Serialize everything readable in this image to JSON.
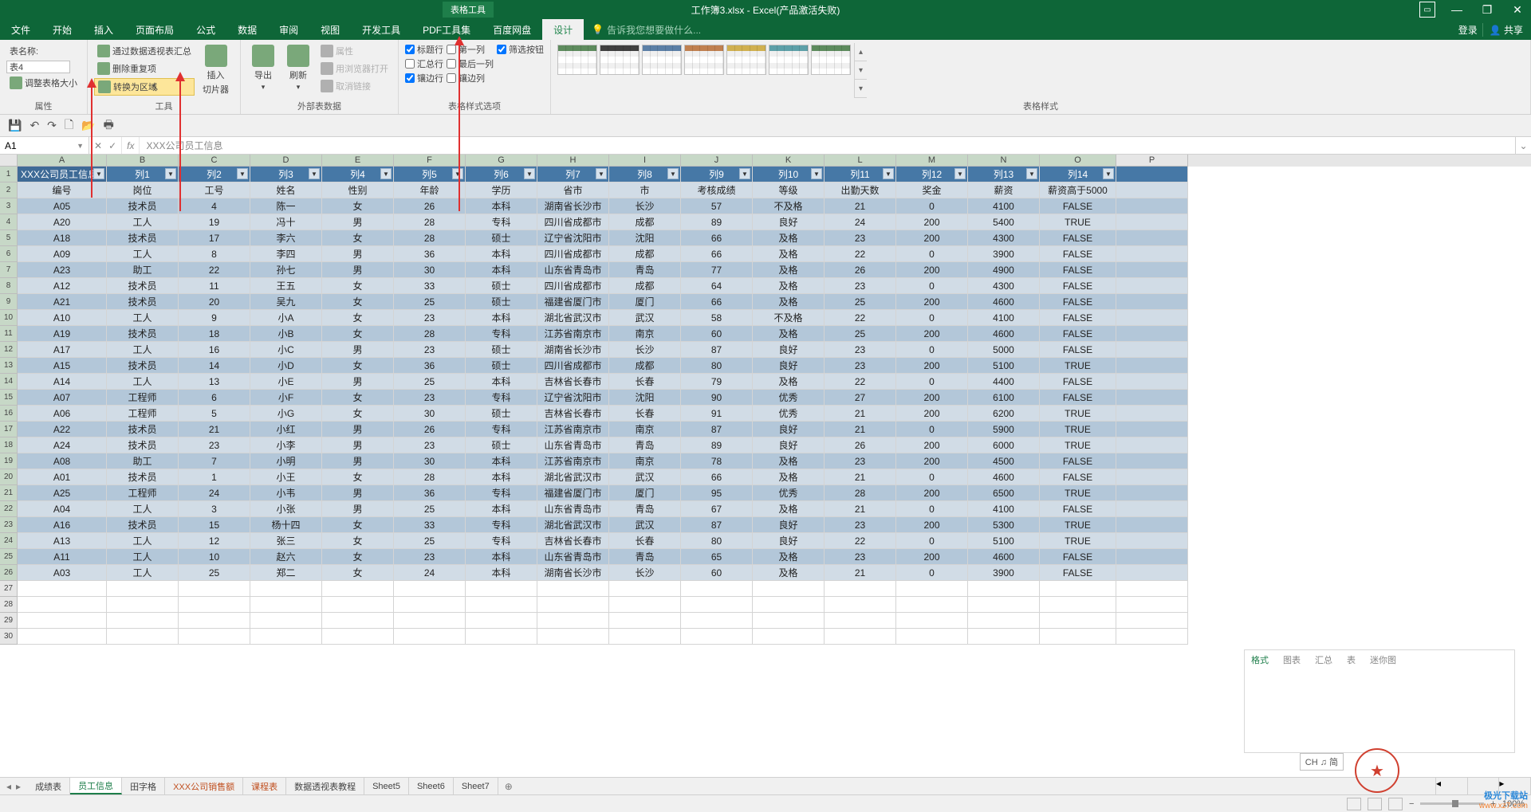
{
  "title": {
    "tool": "表格工具",
    "doc": "工作簿3.xlsx - Excel(产品激活失败)"
  },
  "win": {
    "min": "—",
    "max": "❐",
    "close": "✕",
    "restore": "⤢"
  },
  "tabs": {
    "file": "文件",
    "home": "开始",
    "insert": "插入",
    "layout": "页面布局",
    "formula": "公式",
    "data": "数据",
    "review": "审阅",
    "view": "视图",
    "dev": "开发工具",
    "pdf": "PDF工具集",
    "baidu": "百度网盘",
    "design": "设计",
    "tell": "告诉我您想要做什么...",
    "login": "登录",
    "share": "共享"
  },
  "ribbon": {
    "prop": {
      "name_lbl": "表名称:",
      "name_val": "表4",
      "resize": "调整表格大小",
      "group": "属性"
    },
    "tools": {
      "pivot": "通过数据透视表汇总",
      "dedup": "删除重复项",
      "convert": "转换为区域",
      "slicer_top": "插入",
      "slicer_bot": "切片器",
      "group": "工具"
    },
    "ext": {
      "export": "导出",
      "refresh": "刷新",
      "props": "属性",
      "browser": "用浏览器打开",
      "unlink": "取消链接",
      "group": "外部表数据"
    },
    "styleopt": {
      "hdr": "标题行",
      "total": "汇总行",
      "band_r": "镶边行",
      "first": "第一列",
      "last": "最后一列",
      "band_c": "镶边列",
      "filter": "筛选按钮",
      "group": "表格样式选项"
    },
    "styles": {
      "group": "表格样式"
    }
  },
  "namebox": "A1",
  "formula": "XXX公司员工信息",
  "cols": [
    "A",
    "B",
    "C",
    "D",
    "E",
    "F",
    "G",
    "H",
    "I",
    "J",
    "K",
    "L",
    "M",
    "N",
    "O",
    "P"
  ],
  "thdr": [
    "XXX公司员工信息",
    "列1",
    "列2",
    "列3",
    "列4",
    "列5",
    "列6",
    "列7",
    "列8",
    "列9",
    "列10",
    "列11",
    "列12",
    "列13",
    "列14"
  ],
  "fields": [
    "编号",
    "岗位",
    "工号",
    "姓名",
    "性别",
    "年龄",
    "学历",
    "省市",
    "市",
    "考核成绩",
    "等级",
    "出勤天数",
    "奖金",
    "薪资",
    "薪资高于5000"
  ],
  "rows": [
    [
      "A05",
      "技术员",
      "4",
      "陈一",
      "女",
      "26",
      "本科",
      "湖南省长沙市",
      "长沙",
      "57",
      "不及格",
      "21",
      "0",
      "4100",
      "FALSE"
    ],
    [
      "A20",
      "工人",
      "19",
      "冯十",
      "男",
      "28",
      "专科",
      "四川省成都市",
      "成都",
      "89",
      "良好",
      "24",
      "200",
      "5400",
      "TRUE"
    ],
    [
      "A18",
      "技术员",
      "17",
      "李六",
      "女",
      "28",
      "硕士",
      "辽宁省沈阳市",
      "沈阳",
      "66",
      "及格",
      "23",
      "200",
      "4300",
      "FALSE"
    ],
    [
      "A09",
      "工人",
      "8",
      "李四",
      "男",
      "36",
      "本科",
      "四川省成都市",
      "成都",
      "66",
      "及格",
      "22",
      "0",
      "3900",
      "FALSE"
    ],
    [
      "A23",
      "助工",
      "22",
      "孙七",
      "男",
      "30",
      "本科",
      "山东省青岛市",
      "青岛",
      "77",
      "及格",
      "26",
      "200",
      "4900",
      "FALSE"
    ],
    [
      "A12",
      "技术员",
      "11",
      "王五",
      "女",
      "33",
      "硕士",
      "四川省成都市",
      "成都",
      "64",
      "及格",
      "23",
      "0",
      "4300",
      "FALSE"
    ],
    [
      "A21",
      "技术员",
      "20",
      "吴九",
      "女",
      "25",
      "硕士",
      "福建省厦门市",
      "厦门",
      "66",
      "及格",
      "25",
      "200",
      "4600",
      "FALSE"
    ],
    [
      "A10",
      "工人",
      "9",
      "小A",
      "女",
      "23",
      "本科",
      "湖北省武汉市",
      "武汉",
      "58",
      "不及格",
      "22",
      "0",
      "4100",
      "FALSE"
    ],
    [
      "A19",
      "技术员",
      "18",
      "小B",
      "女",
      "28",
      "专科",
      "江苏省南京市",
      "南京",
      "60",
      "及格",
      "25",
      "200",
      "4600",
      "FALSE"
    ],
    [
      "A17",
      "工人",
      "16",
      "小C",
      "男",
      "23",
      "硕士",
      "湖南省长沙市",
      "长沙",
      "87",
      "良好",
      "23",
      "0",
      "5000",
      "FALSE"
    ],
    [
      "A15",
      "技术员",
      "14",
      "小D",
      "女",
      "36",
      "硕士",
      "四川省成都市",
      "成都",
      "80",
      "良好",
      "23",
      "200",
      "5100",
      "TRUE"
    ],
    [
      "A14",
      "工人",
      "13",
      "小E",
      "男",
      "25",
      "本科",
      "吉林省长春市",
      "长春",
      "79",
      "及格",
      "22",
      "0",
      "4400",
      "FALSE"
    ],
    [
      "A07",
      "工程师",
      "6",
      "小F",
      "女",
      "23",
      "专科",
      "辽宁省沈阳市",
      "沈阳",
      "90",
      "优秀",
      "27",
      "200",
      "6100",
      "FALSE"
    ],
    [
      "A06",
      "工程师",
      "5",
      "小G",
      "女",
      "30",
      "硕士",
      "吉林省长春市",
      "长春",
      "91",
      "优秀",
      "21",
      "200",
      "6200",
      "TRUE"
    ],
    [
      "A22",
      "技术员",
      "21",
      "小红",
      "男",
      "26",
      "专科",
      "江苏省南京市",
      "南京",
      "87",
      "良好",
      "21",
      "0",
      "5900",
      "TRUE"
    ],
    [
      "A24",
      "技术员",
      "23",
      "小李",
      "男",
      "23",
      "硕士",
      "山东省青岛市",
      "青岛",
      "89",
      "良好",
      "26",
      "200",
      "6000",
      "TRUE"
    ],
    [
      "A08",
      "助工",
      "7",
      "小明",
      "男",
      "30",
      "本科",
      "江苏省南京市",
      "南京",
      "78",
      "及格",
      "23",
      "200",
      "4500",
      "FALSE"
    ],
    [
      "A01",
      "技术员",
      "1",
      "小王",
      "女",
      "28",
      "本科",
      "湖北省武汉市",
      "武汉",
      "66",
      "及格",
      "21",
      "0",
      "4600",
      "FALSE"
    ],
    [
      "A25",
      "工程师",
      "24",
      "小韦",
      "男",
      "36",
      "专科",
      "福建省厦门市",
      "厦门",
      "95",
      "优秀",
      "28",
      "200",
      "6500",
      "TRUE"
    ],
    [
      "A04",
      "工人",
      "3",
      "小张",
      "男",
      "25",
      "本科",
      "山东省青岛市",
      "青岛",
      "67",
      "及格",
      "21",
      "0",
      "4100",
      "FALSE"
    ],
    [
      "A16",
      "技术员",
      "15",
      "杨十四",
      "女",
      "33",
      "专科",
      "湖北省武汉市",
      "武汉",
      "87",
      "良好",
      "23",
      "200",
      "5300",
      "TRUE"
    ],
    [
      "A13",
      "工人",
      "12",
      "张三",
      "女",
      "25",
      "专科",
      "吉林省长春市",
      "长春",
      "80",
      "良好",
      "22",
      "0",
      "5100",
      "TRUE"
    ],
    [
      "A11",
      "工人",
      "10",
      "赵六",
      "女",
      "23",
      "本科",
      "山东省青岛市",
      "青岛",
      "65",
      "及格",
      "23",
      "200",
      "4600",
      "FALSE"
    ],
    [
      "A03",
      "工人",
      "25",
      "郑二",
      "女",
      "24",
      "本科",
      "湖南省长沙市",
      "长沙",
      "60",
      "及格",
      "21",
      "0",
      "3900",
      "FALSE"
    ]
  ],
  "sheets": [
    "成绩表",
    "员工信息",
    "田字格",
    "XXX公司销售额",
    "课程表",
    "数据透视表教程",
    "Sheet5",
    "Sheet6",
    "Sheet7"
  ],
  "sheet_active": 1,
  "status": {
    "ready": "",
    "zoom": "100%"
  },
  "ime": "CH ♫ 简",
  "popup": {
    "t1": "格式",
    "t2": "图表",
    "t3": "汇总",
    "t4": "表",
    "t5": "迷你图"
  },
  "wmark": {
    "t1": "极光下载站",
    "t2": "www.xz7.com"
  }
}
